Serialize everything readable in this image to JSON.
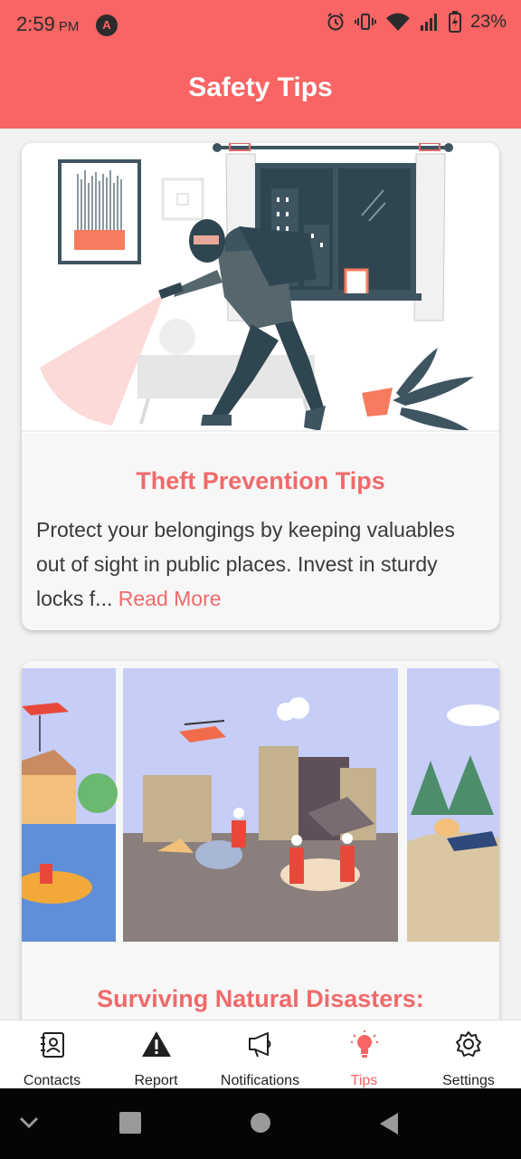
{
  "status_bar": {
    "time": "2:59",
    "ampm": "PM",
    "app_badge": "A",
    "battery": "23%",
    "icons": [
      "alarm-icon",
      "vibrate-icon",
      "wifi-icon",
      "signal-icon",
      "battery-icon"
    ]
  },
  "app_bar": {
    "title": "Safety Tips"
  },
  "cards": [
    {
      "title": "Theft Prevention Tips",
      "text": "Protect your belongings by keeping valuables out of sight in public places. Invest in sturdy locks f...",
      "read_more": "Read More"
    },
    {
      "title": "Surviving Natural Disasters:"
    }
  ],
  "bottom_nav": {
    "items": [
      {
        "label": "Contacts",
        "icon": "contacts-icon"
      },
      {
        "label": "Report",
        "icon": "warning-icon"
      },
      {
        "label": "Notifications",
        "icon": "megaphone-icon"
      },
      {
        "label": "Tips",
        "icon": "lightbulb-icon",
        "active": true
      },
      {
        "label": "Settings",
        "icon": "gear-icon"
      }
    ]
  },
  "colors": {
    "brand": "#f96464",
    "card_title": "#f06a6a",
    "active_tab": "#f96464"
  }
}
